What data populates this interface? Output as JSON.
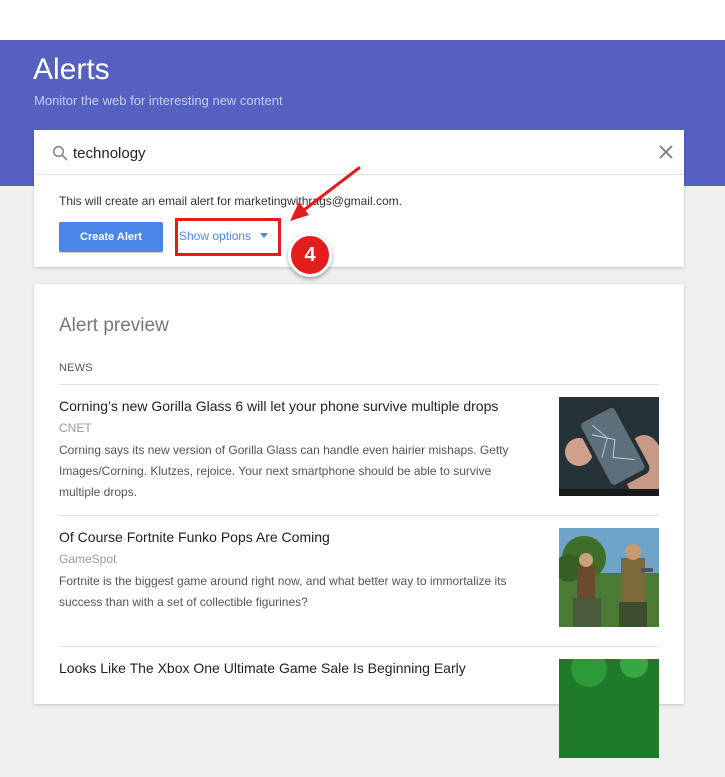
{
  "header": {
    "title": "Alerts",
    "subtitle": "Monitor the web for interesting new content"
  },
  "search": {
    "value": "technology",
    "icon": "search-icon",
    "clear_icon": "close-icon"
  },
  "create_section": {
    "info": "This will create an email alert for marketingwithrags@gmail.com.",
    "create_button": "Create Alert",
    "show_options": "Show options"
  },
  "annotation": {
    "step_number": "4",
    "color": "#e51c1c"
  },
  "preview": {
    "title": "Alert preview",
    "section_label": "NEWS",
    "items": [
      {
        "title": "Corning’s new Gorilla Glass 6 will let your phone survive multiple drops",
        "source": "CNET",
        "description": "Corning says its new version of Gorilla Glass can handle even hairier mishaps. Getty Images/Corning. Klutzes, rejoice. Your next smartphone should be able to survive multiple drops."
      },
      {
        "title": "Of Course Fortnite Funko Pops Are Coming",
        "source": "GameSpot",
        "description": "Fortnite is the biggest game around right now, and what better way to immortalize its success than with a set of collectible figurines?"
      },
      {
        "title": "Looks Like The Xbox One Ultimate Game Sale Is Beginning Early",
        "source": "",
        "description": ""
      }
    ]
  },
  "colors": {
    "header_bg": "#5561c0",
    "accent": "#4a86e8"
  }
}
